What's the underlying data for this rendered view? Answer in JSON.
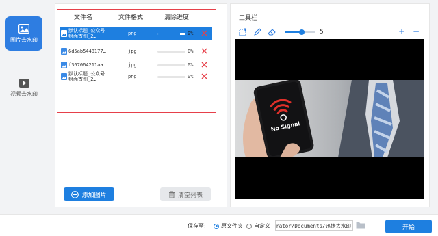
{
  "nav": {
    "items": [
      {
        "label": "图片去水印",
        "icon": "image-icon",
        "active": true
      },
      {
        "label": "视频去水印",
        "icon": "video-icon",
        "active": false
      }
    ]
  },
  "file_list": {
    "columns": [
      "文件名",
      "文件格式",
      "清除进度"
    ],
    "rows": [
      {
        "name": "默认标题_公众号封面首图_2…",
        "format": "png",
        "progress_pct": "0%",
        "progress": 0.8,
        "selected": true
      },
      {
        "name": "6d5ab5448177…",
        "format": "jpg",
        "progress_pct": "0%",
        "progress": 0,
        "selected": false
      },
      {
        "name": "f367064211aa…",
        "format": "jpg",
        "progress_pct": "0%",
        "progress": 0,
        "selected": false
      },
      {
        "name": "默认标题_公众号封面首图_2…",
        "format": "png",
        "progress_pct": "0%",
        "progress": 0,
        "selected": false
      }
    ],
    "add_button": "添加图片",
    "clear_button": "清空列表"
  },
  "toolbar": {
    "title": "工具栏",
    "brush_size": "5",
    "brush_level": 0.55
  },
  "preview": {
    "phone_text": "No Signal"
  },
  "bottom": {
    "save_label": "保存至:",
    "option_original": "原文件夹",
    "option_custom": "自定义",
    "path_value": "Administrator/Documents/迅捷去水印",
    "start_button": "开始"
  },
  "colors": {
    "accent": "#1e7fe0",
    "highlight_border": "#e6404a",
    "delete": "#e6404a"
  }
}
